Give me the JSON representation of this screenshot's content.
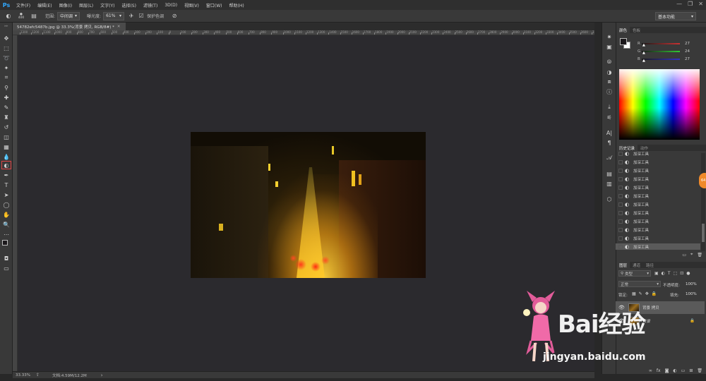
{
  "menubar": {
    "logo": "Ps",
    "items": [
      "文件(F)",
      "编辑(E)",
      "图像(I)",
      "图层(L)",
      "文字(Y)",
      "选择(S)",
      "滤镜(T)",
      "3D(D)",
      "视图(V)",
      "窗口(W)",
      "帮助(H)"
    ],
    "window_controls": [
      "—",
      "❐",
      "✕"
    ]
  },
  "options": {
    "brush_size": "400",
    "range_label": "范围:",
    "range_value": "中间调",
    "exposure_label": "曝光度:",
    "exposure_value": "61%",
    "protect_tones_label": "保护色调",
    "workspace": "基本功能"
  },
  "document": {
    "tab_title": "54782efc5487b.jpg @ 33.3%(背景 拷贝, RGB/8#) *",
    "ruler_ticks": [
      "1300",
      "1200",
      "1100",
      "1000",
      "900",
      "800",
      "700",
      "600",
      "500",
      "400",
      "300",
      "200",
      "100",
      "0",
      "100",
      "200",
      "300",
      "400",
      "500",
      "600",
      "700",
      "800",
      "900",
      "1000",
      "1100",
      "1200",
      "1300",
      "1400",
      "1500",
      "1600",
      "1700",
      "1800",
      "1900",
      "2000",
      "2100",
      "2200",
      "2300",
      "2400",
      "2500",
      "2600",
      "2700",
      "2800",
      "2900",
      "3000",
      "3100",
      "3200",
      "3300",
      "3400",
      "3500",
      "3600",
      "3700",
      "3800",
      "3900"
    ]
  },
  "status": {
    "zoom": "33.33%",
    "doc_info": "文档:4.59M/12.2M"
  },
  "color_panel": {
    "tabs": [
      "颜色",
      "色板"
    ],
    "channels": [
      {
        "label": "R",
        "value": "27",
        "color": "#c83232"
      },
      {
        "label": "G",
        "value": "24",
        "color": "#32c832"
      },
      {
        "label": "B",
        "value": "27",
        "color": "#3232c8"
      }
    ]
  },
  "history_panel": {
    "tabs": [
      "历史记录",
      "动作"
    ],
    "items": [
      "加深工具",
      "加深工具",
      "加深工具",
      "加深工具",
      "加深工具",
      "加深工具",
      "加深工具",
      "加深工具",
      "加深工具",
      "加深工具",
      "加深工具",
      "加深工具",
      "加深工具",
      "加深工具"
    ]
  },
  "layers_panel": {
    "tabs": [
      "图层",
      "通道",
      "路径"
    ],
    "filter_label": "类型",
    "blend_mode": "正常",
    "opacity_label": "不透明度:",
    "opacity_value": "100%",
    "lock_label": "锁定:",
    "fill_label": "填充:",
    "fill_value": "100%",
    "layers": [
      {
        "name": "背景 拷贝",
        "selected": true
      },
      {
        "name": "背景",
        "selected": false
      }
    ]
  },
  "watermark": {
    "brand": "Bai经验",
    "url": "jingyan.baidu.com"
  },
  "badge": "64"
}
